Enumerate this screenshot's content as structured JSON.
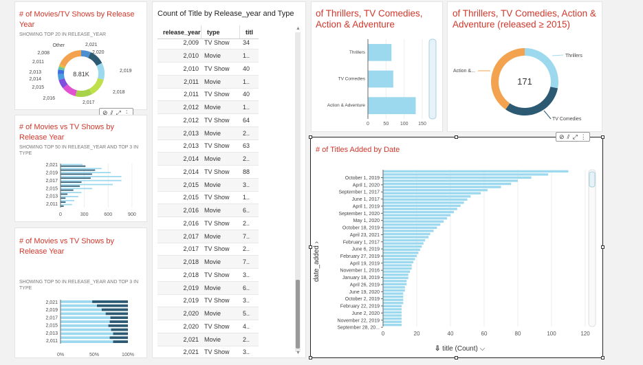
{
  "card1": {
    "title": "# of Movies/TV Shows by Release Year",
    "subtitle": "SHOWING TOP 20 IN RELEASE_YEAR",
    "center_value": "8.81K",
    "labels": [
      "Other",
      "2,021",
      "2,020",
      "2,019",
      "2,018",
      "2,017",
      "2,016",
      "2,015",
      "2,014",
      "2,013",
      "2,011",
      "2,008"
    ]
  },
  "card2": {
    "title": "# of Movies vs TV Shows by Release Year",
    "subtitle": "SHOWING TOP 50 IN RELEASE_YEAR AND TOP 3 IN TYPE"
  },
  "card3": {
    "title": "# of Movies vs TV Shows by Release Year",
    "subtitle": "SHOWING TOP 50 IN RELEASE_YEAR AND TOP 3 IN TYPE"
  },
  "table": {
    "title": "Count of Title by Release_year and Type",
    "headers": [
      "release_year",
      "type",
      "titl"
    ],
    "rows": [
      [
        "2,009",
        "TV Show",
        "34"
      ],
      [
        "2,010",
        "Movie",
        "1.."
      ],
      [
        "2,010",
        "TV Show",
        "40"
      ],
      [
        "2,011",
        "Movie",
        "1.."
      ],
      [
        "2,011",
        "TV Show",
        "40"
      ],
      [
        "2,012",
        "Movie",
        "1.."
      ],
      [
        "2,012",
        "TV Show",
        "64"
      ],
      [
        "2,013",
        "Movie",
        "2.."
      ],
      [
        "2,013",
        "TV Show",
        "63"
      ],
      [
        "2,014",
        "Movie",
        "2.."
      ],
      [
        "2,014",
        "TV Show",
        "88"
      ],
      [
        "2,015",
        "Movie",
        "3.."
      ],
      [
        "2,015",
        "TV Show",
        "1.."
      ],
      [
        "2,016",
        "Movie",
        "6.."
      ],
      [
        "2,016",
        "TV Show",
        "2.."
      ],
      [
        "2,017",
        "Movie",
        "7.."
      ],
      [
        "2,017",
        "TV Show",
        "2.."
      ],
      [
        "2,018",
        "Movie",
        "7.."
      ],
      [
        "2,018",
        "TV Show",
        "3.."
      ],
      [
        "2,019",
        "Movie",
        "6.."
      ],
      [
        "2,019",
        "TV Show",
        "3.."
      ],
      [
        "2,020",
        "Movie",
        "5.."
      ],
      [
        "2,020",
        "TV Show",
        "4.."
      ],
      [
        "2,021",
        "Movie",
        "2.."
      ],
      [
        "2,021",
        "TV Show",
        "3.."
      ]
    ]
  },
  "card4": {
    "title": "of Thrillers, TV Comedies, Action & Adventure"
  },
  "card5": {
    "title": "of Thrillers, TV Comedies, Action & Adventure (released ≥ 2015)",
    "center_value": "171",
    "labels": [
      "Thrillers",
      "Action &...",
      "TV Comedies"
    ]
  },
  "card6": {
    "title": "# of Titles Added by Date",
    "ylabel": "date_added",
    "xlabel": "title (Count)"
  },
  "toolbar_icons": [
    "filter-icon",
    "analyze-icon",
    "expand-icon",
    "more-icon"
  ],
  "colors": {
    "accent_red": "#d0372b",
    "bar_light": "#9dd9ee",
    "bar_dark": "#2c5a73",
    "orange": "#f3a34f",
    "selection_border": "#222222"
  },
  "chart_data": [
    {
      "type": "pie",
      "title": "# of Movies/TV Shows by Release Year",
      "center_total": "8.81K",
      "categories": [
        "2,021",
        "2,020",
        "2,019",
        "2,018",
        "2,017",
        "2,016",
        "2,015",
        "2,014",
        "2,013",
        "2,011",
        "2,008",
        "Other"
      ],
      "values": [
        592,
        953,
        1030,
        1147,
        1032,
        902,
        560,
        352,
        288,
        185,
        136,
        1630
      ],
      "colors": [
        "#4e8fd0",
        "#2c5a73",
        "#9dd9ee",
        "#bfe04a",
        "#a7d24a",
        "#e052d0",
        "#7f4fe0",
        "#4b9de0",
        "#3f6fe0",
        "#67c4a6",
        "#e0c040",
        "#f3a34f"
      ]
    },
    {
      "type": "bar",
      "orientation": "horizontal",
      "title": "# of Movies vs TV Shows by Release Year",
      "categories": [
        "2,021",
        "2,020",
        "2,019",
        "2,018",
        "2,017",
        "2,016",
        "2,015",
        "2,014",
        "2,013",
        "2,012",
        "2,011"
      ],
      "tick_labels": [
        "2,021",
        "2,019",
        "2,017",
        "2,015",
        "2,013",
        "2,011"
      ],
      "series": [
        {
          "values": [
            277,
            517,
            633,
            767,
            767,
            658,
            398,
            264,
            225,
            173,
            145
          ]
        },
        {
          "values": [
            315,
            436,
            397,
            380,
            265,
            244,
            162,
            88,
            63,
            64,
            40
          ]
        }
      ],
      "xlim": [
        0,
        1000
      ],
      "xticks": [
        0,
        300,
        600,
        900
      ]
    },
    {
      "type": "bar",
      "orientation": "horizontal",
      "stacking": "percent",
      "title": "# of Movies vs TV Shows by Release Year",
      "categories": [
        "2,021",
        "2,020",
        "2,019",
        "2,018",
        "2,017",
        "2,016",
        "2,015",
        "2,014",
        "2,013",
        "2,012",
        "2,011"
      ],
      "tick_labels": [
        "2,021",
        "2,019",
        "2,017",
        "2,015",
        "2,013",
        "2,011"
      ],
      "series": [
        {
          "values": [
            0.47,
            0.54,
            0.61,
            0.67,
            0.74,
            0.73,
            0.71,
            0.75,
            0.78,
            0.73,
            0.78
          ]
        },
        {
          "values": [
            0.53,
            0.46,
            0.39,
            0.33,
            0.26,
            0.27,
            0.29,
            0.25,
            0.22,
            0.27,
            0.22
          ]
        }
      ],
      "xticks": [
        "0%",
        "50%",
        "100%"
      ]
    },
    {
      "type": "bar",
      "orientation": "horizontal",
      "title": "of Thrillers, TV Comedies, Action & Adventure",
      "categories": [
        "Thrillers",
        "TV Comedies",
        "Action & Adventure"
      ],
      "values": [
        65,
        70,
        132
      ],
      "xticks": [
        0,
        50,
        100,
        150
      ],
      "xlim": [
        0,
        150
      ]
    },
    {
      "type": "pie",
      "title": "of Thrillers, TV Comedies, Action & Adventure (released ≥ 2015)",
      "center_total": "171",
      "categories": [
        "Thrillers",
        "TV Comedies",
        "Action &..."
      ],
      "values": [
        48,
        54,
        69
      ],
      "colors": [
        "#9dd9ee",
        "#2c5a73",
        "#f3a34f"
      ]
    },
    {
      "type": "bar",
      "orientation": "horizontal",
      "title": "# of Titles Added by Date",
      "xlabel": "title (Count)",
      "ylabel": "date_added",
      "tick_labels": [
        "October 1, 2019",
        "April 1, 2020",
        "September 1, 2017",
        "June 1, 2017",
        "April 1, 2019",
        "September 1, 2020",
        "May 1, 2020",
        "October 18, 2019",
        "April 23, 2021",
        "February 1, 2017",
        "June 6, 2019",
        "February 27, 2019",
        "April 19, 2019",
        "November 1, 2016",
        "January 18, 2019",
        "April 26, 2019",
        "June 19, 2020",
        "October 2, 2019",
        "February 22, 2019",
        "June 2, 2020",
        "November 22, 2019",
        "September 28, 20..."
      ],
      "values": [
        110,
        98,
        88,
        80,
        76,
        70,
        62,
        58,
        52,
        50,
        48,
        46,
        44,
        42,
        40,
        38,
        36,
        34,
        32,
        30,
        28,
        27,
        25,
        24,
        23,
        22,
        21,
        20,
        19,
        18,
        17,
        17,
        16,
        15,
        15,
        14,
        14,
        13,
        13,
        12,
        12,
        12,
        12,
        11,
        11,
        11,
        11,
        11,
        11,
        11
      ],
      "xticks": [
        0,
        20,
        40,
        60,
        80,
        100,
        120
      ],
      "xlim": [
        0,
        120
      ]
    }
  ]
}
